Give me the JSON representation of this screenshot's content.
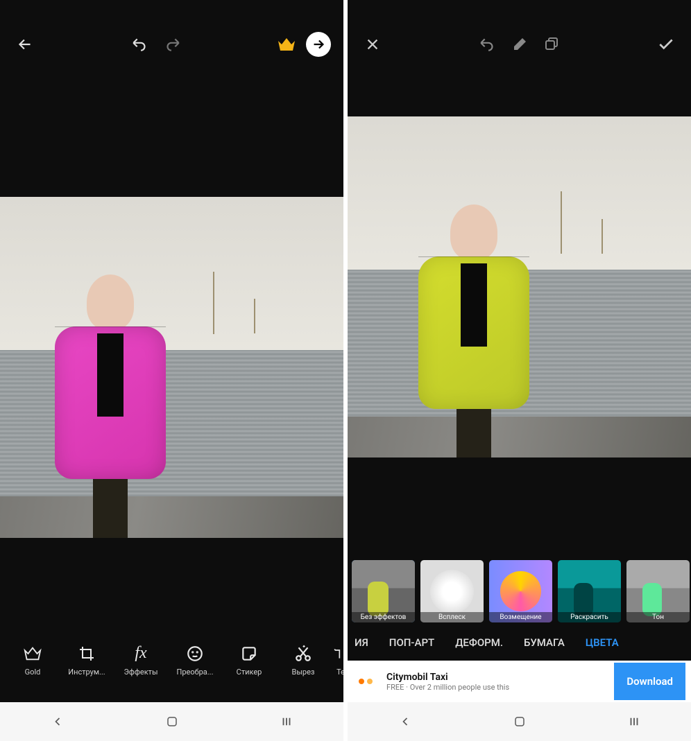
{
  "left": {
    "tools": [
      {
        "label": "Gold",
        "icon": "crown"
      },
      {
        "label": "Инструм...",
        "icon": "crop"
      },
      {
        "label": "Эффекты",
        "icon": "fx"
      },
      {
        "label": "Преобра...",
        "icon": "face"
      },
      {
        "label": "Стикер",
        "icon": "sticker"
      },
      {
        "label": "Вырез",
        "icon": "cutout"
      },
      {
        "label": "Те",
        "icon": "text"
      }
    ]
  },
  "right": {
    "filters": [
      {
        "label": "Без эффектов",
        "selected": true,
        "style": "yellow"
      },
      {
        "label": "Всплеск",
        "selected": false,
        "style": "splash"
      },
      {
        "label": "Возмещение",
        "selected": false,
        "style": "flower"
      },
      {
        "label": "Раскрасить",
        "selected": false,
        "style": "teal"
      },
      {
        "label": "Тон",
        "selected": false,
        "style": "green"
      }
    ],
    "categories": [
      {
        "label": "ИЯ",
        "active": false
      },
      {
        "label": "ПОП-АРТ",
        "active": false
      },
      {
        "label": "ДЕФОРМ.",
        "active": false
      },
      {
        "label": "БУМАГА",
        "active": false
      },
      {
        "label": "ЦВЕТА",
        "active": true
      }
    ],
    "ad": {
      "title": "Citymobil Taxi",
      "subtitle": "FREE · Over 2 million people use this",
      "button": "Download"
    }
  }
}
